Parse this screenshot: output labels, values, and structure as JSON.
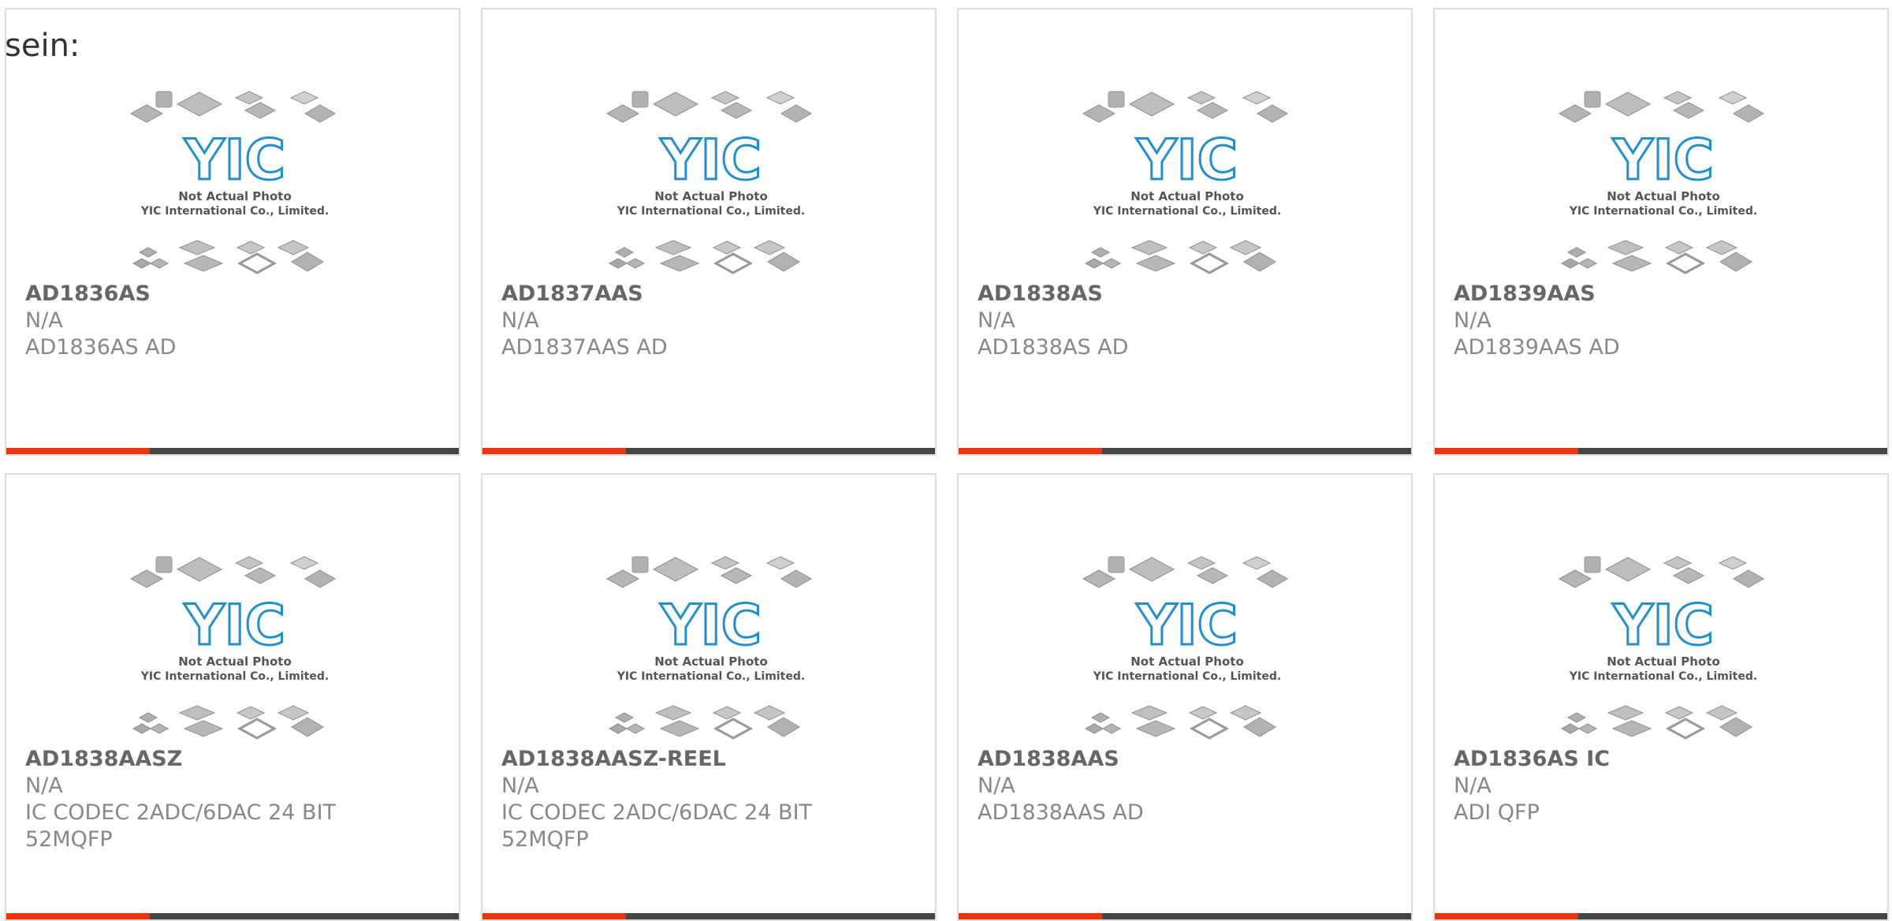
{
  "intro_text": "sein:",
  "photo": {
    "caption_line1": "Not Actual Photo",
    "caption_line2": "YIC International Co., Limited.",
    "logo_text": "YIC"
  },
  "colors": {
    "accent": "#e8350c",
    "bar": "#444444",
    "logo_blue": "#1f8fd0"
  },
  "products": [
    {
      "part": "AD1836AS",
      "line1": "N/A",
      "line2": "AD1836AS AD",
      "line3": ""
    },
    {
      "part": "AD1837AAS",
      "line1": "N/A",
      "line2": "AD1837AAS AD",
      "line3": ""
    },
    {
      "part": "AD1838AS",
      "line1": "N/A",
      "line2": "AD1838AS AD",
      "line3": ""
    },
    {
      "part": "AD1839AAS",
      "line1": "N/A",
      "line2": "AD1839AAS AD",
      "line3": ""
    },
    {
      "part": "AD1838AASZ",
      "line1": "N/A",
      "line2": "IC CODEC 2ADC/6DAC 24 BIT",
      "line3": "52MQFP"
    },
    {
      "part": "AD1838AASZ-REEL",
      "line1": "N/A",
      "line2": "IC CODEC 2ADC/6DAC 24 BIT",
      "line3": "52MQFP"
    },
    {
      "part": "AD1838AAS",
      "line1": "N/A",
      "line2": "AD1838AAS AD",
      "line3": ""
    },
    {
      "part": "AD1836AS IC",
      "line1": "N/A",
      "line2": "ADI QFP",
      "line3": ""
    }
  ]
}
